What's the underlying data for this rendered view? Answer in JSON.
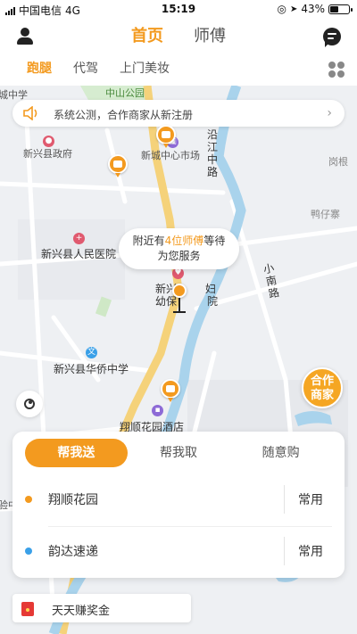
{
  "status_bar": {
    "carrier": "中国电信",
    "network": "4G",
    "time": "15:19",
    "battery": "43%",
    "battery_level": 0.43
  },
  "header": {
    "tabs": [
      "首页",
      "师傅"
    ],
    "active_tab": 0
  },
  "sub_tabs": {
    "items": [
      "跑腿",
      "代驾",
      "上门美妆"
    ],
    "active": 0
  },
  "notice": {
    "text": "系统公测，合作商家从新注册"
  },
  "map": {
    "labels": {
      "chengzhongxue": "城中学",
      "zhongshan_park": "中山公园",
      "gov": "新兴县政府",
      "market": "新城中心市场",
      "yanjiang": "沿江中路",
      "ganggen": "岗根",
      "yazaixiao": "鸭仔寨",
      "hospital": "新兴县人民医院",
      "xiaonan": "小南路",
      "fuyou_a": "新兴",
      "fuyou_b": "妇",
      "fuyou_c": "幼保",
      "fuyou_d": "院",
      "huaqiao": "新兴县华侨中学",
      "hotel": "翔顺花园酒店",
      "left_edge": "验中"
    },
    "nearby_bubble": {
      "prefix": "附近有",
      "highlight": "4位师傅",
      "suffix": "等待",
      "line2": "为您服务"
    },
    "partner_badge": {
      "line1": "合作",
      "line2": "商家"
    }
  },
  "panel": {
    "tabs": [
      "帮我送",
      "帮我取",
      "随意购"
    ],
    "active_tab": 0,
    "addresses": [
      {
        "name": "翔顺花园",
        "action": "常用",
        "dot_color": "#f39a1f"
      },
      {
        "name": "韵达速递",
        "action": "常用",
        "dot_color": "#3aa0e8"
      }
    ]
  },
  "reward": {
    "text": "天天赚奖金"
  },
  "colors": {
    "accent": "#f39a1f",
    "river": "#a9d3ec",
    "road_main": "#f5d27a"
  }
}
